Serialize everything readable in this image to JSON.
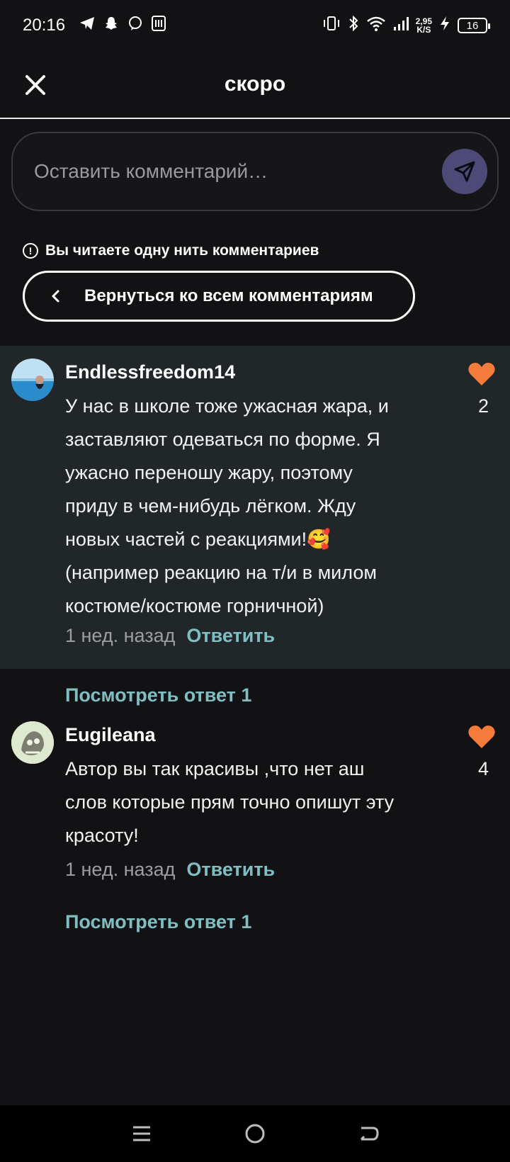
{
  "status_bar": {
    "time": "20:16",
    "speed_value": "2,95",
    "speed_unit": "K/S",
    "battery": "16"
  },
  "header": {
    "title": "скоро"
  },
  "comment_input": {
    "placeholder": "Оставить комментарий…"
  },
  "thread": {
    "notice": "Вы читаете одну нить комментариев",
    "back_label": "Вернуться ко всем комментариям"
  },
  "comments": [
    {
      "username": "Endlessfreedom14",
      "text": "У нас в школе тоже ужасная жара, и\nзаставляют одеваться по форме. Я\nужасно переношу жару, поэтому\nприду в чем-нибудь лёгком. Жду\nновых частей с реакциями!🥰\n(например реакцию на т/и в милом\nкостюме/костюме горничной)",
      "time": "1 нед. назад",
      "reply_label": "Ответить",
      "likes": "2",
      "view_replies": "Посмотреть ответ 1"
    },
    {
      "username": "Eugileana",
      "text": "Автор вы так красивы ,что нет аш\nслов которые прям точно опишут эту\nкрасоту!",
      "time": "1 нед. назад",
      "reply_label": "Ответить",
      "likes": "4",
      "view_replies": "Посмотреть ответ 1"
    }
  ],
  "colors": {
    "background": "#121114",
    "highlight": "#212629",
    "accent_link": "#7fbfc3",
    "heart": "#f47b3a",
    "send_button": "#4e4a78"
  },
  "icons": [
    "telegram-icon",
    "snapchat-icon",
    "viber-icon",
    "nfc-icon",
    "vibrate-icon",
    "bluetooth-icon",
    "wifi-icon",
    "signal-icon",
    "charging-icon",
    "close-icon",
    "send-icon",
    "info-icon",
    "chevron-left-icon",
    "heart-icon",
    "menu-icon",
    "home-icon",
    "back-icon"
  ]
}
